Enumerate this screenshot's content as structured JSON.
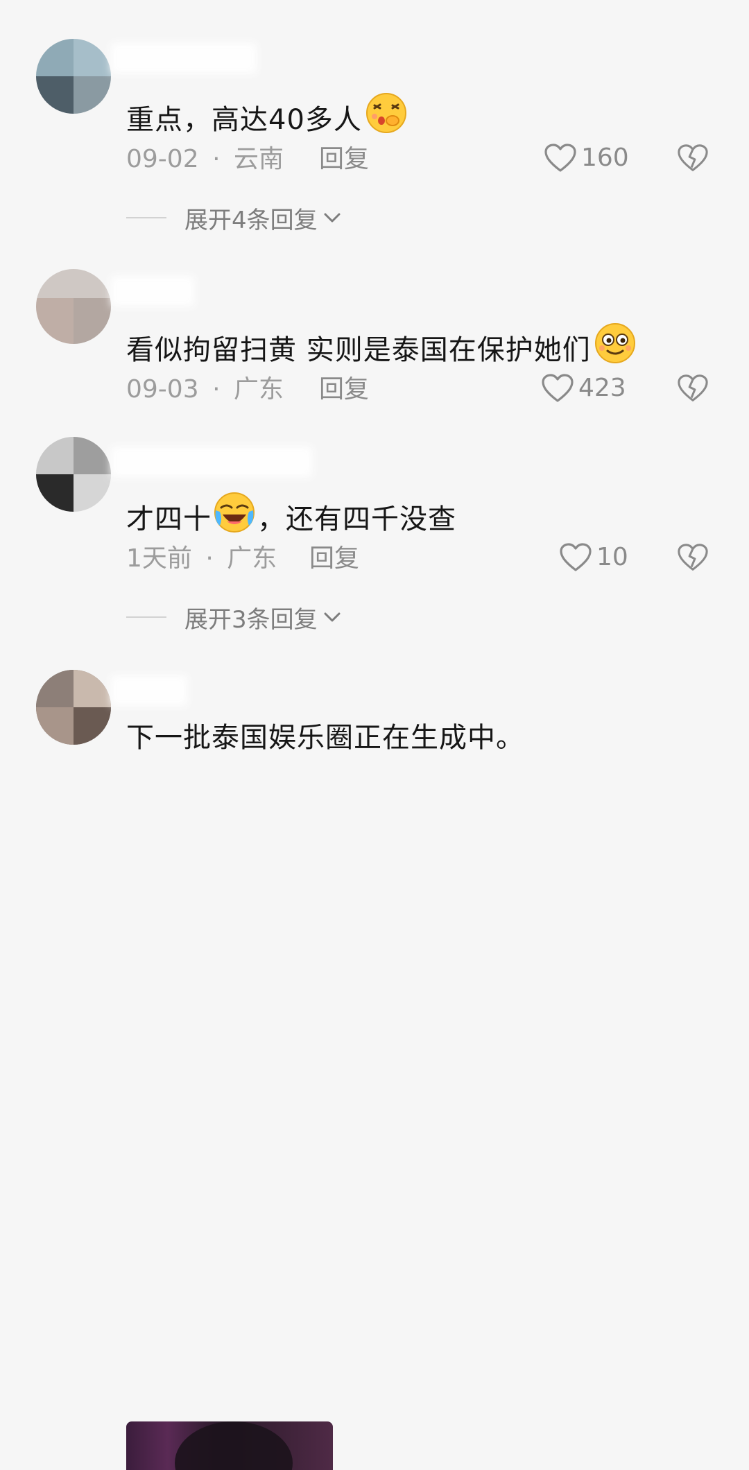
{
  "comments": [
    {
      "text": "重点，高达40多人",
      "emoji": "shush-face-emoji",
      "date": "09-02",
      "location": "云南",
      "reply_label": "回复",
      "likes": "160",
      "expand_label": "展开4条回复"
    },
    {
      "text": "看似拘留扫黄 实则是泰国在保护她们",
      "emoji": "smiling-face-emoji",
      "date": "09-03",
      "location": "广东",
      "reply_label": "回复",
      "likes": "423"
    },
    {
      "text_before": "才四十",
      "emoji": "laughing-crying-emoji",
      "text_after": "，还有四千没查",
      "date": "1天前",
      "location": "广东",
      "reply_label": "回复",
      "likes": "10",
      "expand_label": "展开3条回复"
    },
    {
      "text": "下一批泰国娱乐圈正在生成中。"
    }
  ],
  "meta_separator": "·",
  "icons": {
    "like": "heart-outline-icon",
    "dislike": "broken-heart-icon",
    "expand": "chevron-down-icon"
  },
  "colors": {
    "background": "#f6f6f6",
    "text": "#161616",
    "meta": "#9c9c9c"
  }
}
